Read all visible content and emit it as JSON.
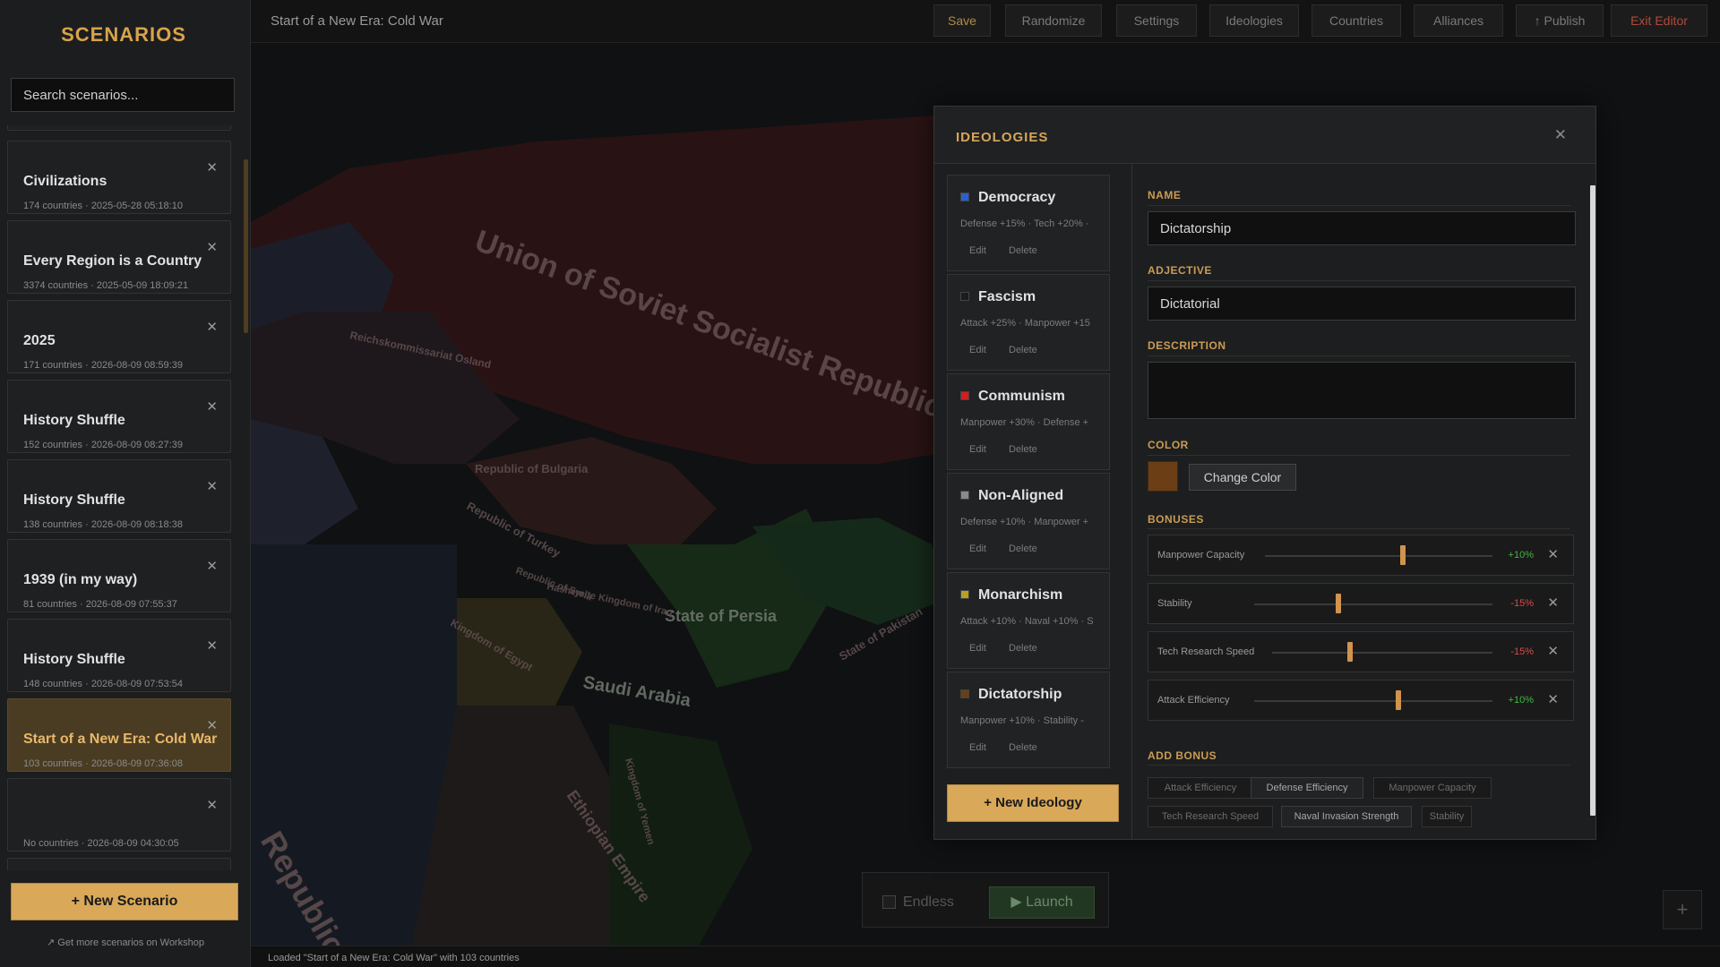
{
  "sidebar": {
    "title": "SCENARIOS",
    "search_placeholder": "Search scenarios...",
    "scenarios": [
      {
        "name": "Civilizations",
        "meta": "174 countries · 2025-05-28 05:18:10"
      },
      {
        "name": "Every Region is a Country",
        "meta": "3374 countries · 2025-05-09 18:09:21"
      },
      {
        "name": "2025",
        "meta": "171 countries · 2026-08-09 08:59:39"
      },
      {
        "name": "History Shuffle",
        "meta": "152 countries · 2026-08-09 08:27:39"
      },
      {
        "name": "History Shuffle",
        "meta": "138 countries · 2026-08-09 08:18:38"
      },
      {
        "name": "1939 (in my way)",
        "meta": "81 countries · 2026-08-09 07:55:37"
      },
      {
        "name": "History Shuffle",
        "meta": "148 countries · 2026-08-09 07:53:54"
      },
      {
        "name": "Start of a New Era: Cold War",
        "meta": "103 countries · 2026-08-09 07:36:08",
        "selected": true
      },
      {
        "name": "",
        "meta": "No countries · 2026-08-09 04:30:05"
      }
    ],
    "close_glyph": "✕",
    "new_button": "+ New Scenario",
    "workshop_link": "↗ Get more scenarios on Workshop"
  },
  "topbar": {
    "title": "Start of a New Era: Cold War",
    "buttons": {
      "save": "Save",
      "randomize": "Randomize",
      "settings": "Settings",
      "ideologies": "Ideologies",
      "countries": "Countries",
      "alliances": "Alliances",
      "publish": "↑ Publish",
      "exit": "Exit Editor"
    }
  },
  "map": {
    "labels": [
      "Union of Soviet Socialist Republics",
      "State of Persia",
      "Saudi Arabia",
      "Reichskommissariat Osland",
      "Republic of Turkey",
      "Republic of Syria",
      "Hashemite Kingdom of Iraq",
      "Kingdom of Egypt",
      "Ethiopian Empire",
      "Republic of Bulgaria",
      "State of Pakistan",
      "Kingdom of Yemen",
      "Republic"
    ]
  },
  "launch_bar": {
    "endless_label": "Endless",
    "launch_label": "▶  Launch",
    "plus": "+"
  },
  "status": {
    "text": "Loaded \"Start of a New Era: Cold War\" with 103 countries"
  },
  "dialog": {
    "title": "IDEOLOGIES",
    "close": "✕",
    "ideologies": [
      {
        "name": "Democracy",
        "desc": "Defense +15% · Tech +20% ·",
        "color": "#2a5fd0",
        "edit": "Edit",
        "delete": "Delete"
      },
      {
        "name": "Fascism",
        "desc": "Attack +25% · Manpower +15",
        "color": "#1b1b1b",
        "edit": "Edit",
        "delete": "Delete"
      },
      {
        "name": "Communism",
        "desc": "Manpower +30% · Defense +",
        "color": "#d21e1e",
        "edit": "Edit",
        "delete": "Delete"
      },
      {
        "name": "Non-Aligned",
        "desc": "Defense +10% · Manpower +",
        "color": "#8a8a8a",
        "edit": "Edit",
        "delete": "Delete"
      },
      {
        "name": "Monarchism",
        "desc": "Attack +10% · Naval +10% · S",
        "color": "#b8a020",
        "edit": "Edit",
        "delete": "Delete"
      },
      {
        "name": "Dictatorship",
        "desc": "Manpower +10% · Stability -",
        "color": "#6b3e15",
        "edit": "Edit",
        "delete": "Delete"
      }
    ],
    "new_button": "+ New Ideology",
    "form": {
      "name_label": "NAME",
      "name_value": "Dictatorship",
      "adjective_label": "ADJECTIVE",
      "adjective_value": "Dictatorial",
      "description_label": "DESCRIPTION",
      "description_value": "",
      "color_label": "COLOR",
      "color_value": "#6b3e15",
      "change_color": "Change Color",
      "bonuses_label": "BONUSES",
      "bonuses": [
        {
          "name": "Manpower Capacity",
          "value": "+10%",
          "level": 0.6,
          "positive": true
        },
        {
          "name": "Stability",
          "value": "-15%",
          "level": 0.35,
          "positive": false
        },
        {
          "name": "Tech Research Speed",
          "value": "-15%",
          "level": 0.35,
          "positive": false
        },
        {
          "name": "Attack Efficiency",
          "value": "+10%",
          "level": 0.6,
          "positive": true
        }
      ],
      "add_bonus_label": "ADD BONUS",
      "add_bonus_options": [
        {
          "name": "Attack Efficiency",
          "highlight": false
        },
        {
          "name": "Defense Efficiency",
          "highlight": true
        },
        {
          "name": "Manpower Capacity",
          "highlight": false
        },
        {
          "name": "Tech Research Speed",
          "highlight": false
        },
        {
          "name": "Naval Invasion Strength",
          "highlight": true
        },
        {
          "name": "Stability",
          "highlight": false
        }
      ]
    }
  },
  "colors": {
    "accent": "#d9a859",
    "positive": "#3fb83f",
    "negative": "#d84a4a"
  }
}
